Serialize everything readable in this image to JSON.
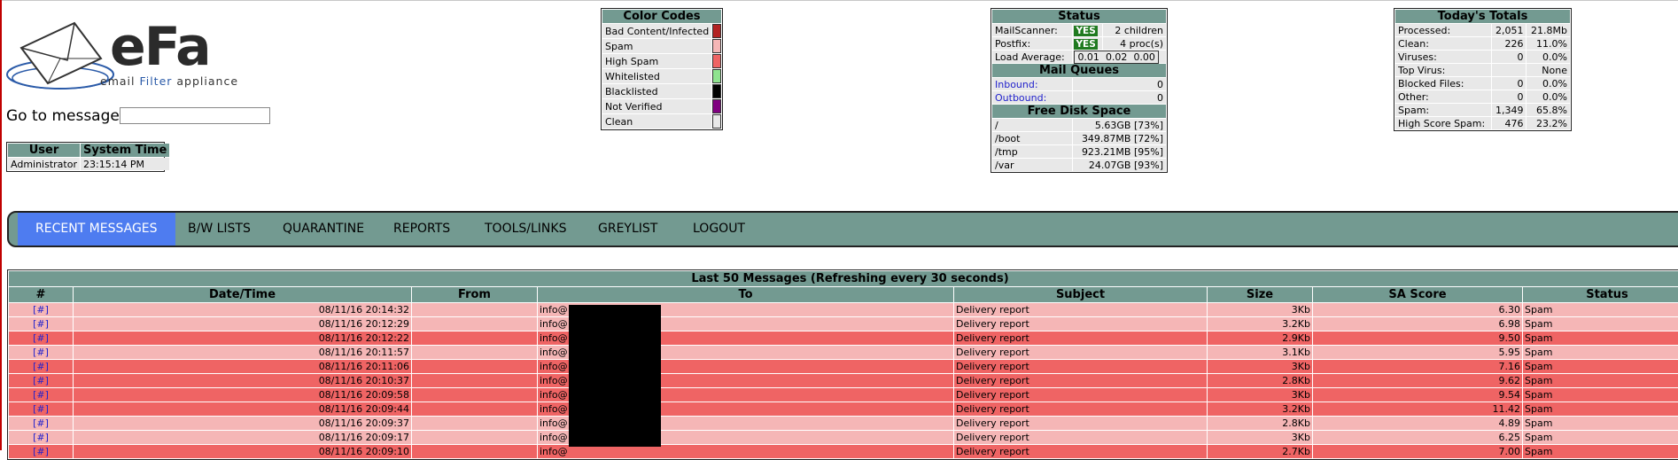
{
  "logo": {
    "main": "eFa",
    "sub_1": "email ",
    "sub_2": "Filter",
    "sub_3": " appliance"
  },
  "goto": {
    "label": "Go to message:",
    "value": ""
  },
  "user_box": {
    "headers": [
      "User",
      "System Time"
    ],
    "user": "Administrator",
    "time": "23:15:14 PM"
  },
  "color_codes": {
    "title": "Color Codes",
    "items": [
      {
        "label": "Bad Content/Infected",
        "color": "#b22222"
      },
      {
        "label": "Spam",
        "color": "#f5b6b6"
      },
      {
        "label": "High Spam",
        "color": "#ef6464"
      },
      {
        "label": "Whitelisted",
        "color": "#8fe38f"
      },
      {
        "label": "Blacklisted",
        "color": "#000000"
      },
      {
        "label": "Not Verified",
        "color": "#800080"
      },
      {
        "label": "Clean",
        "color": "#e8e8e8"
      }
    ]
  },
  "status": {
    "title": "Status",
    "mailscanner": {
      "label": "MailScanner:",
      "flag": "YES",
      "detail": "2 children"
    },
    "postfix": {
      "label": "Postfix:",
      "flag": "YES",
      "detail": "4 proc(s)"
    },
    "load": {
      "label": "Load Average:",
      "values": [
        "0.01",
        "0.02",
        "0.00"
      ]
    },
    "queues_title": "Mail Queues",
    "inbound": {
      "label": "Inbound:",
      "value": "0"
    },
    "outbound": {
      "label": "Outbound:",
      "value": "0"
    },
    "disk_title": "Free Disk Space",
    "disks": [
      {
        "mount": "/",
        "free": "5.63GB [73%]"
      },
      {
        "mount": "/boot",
        "free": "349.87MB [72%]"
      },
      {
        "mount": "/tmp",
        "free": "923.21MB [95%]"
      },
      {
        "mount": "/var",
        "free": "24.07GB [93%]"
      }
    ]
  },
  "totals": {
    "title": "Today's Totals",
    "rows": [
      {
        "label": "Processed:",
        "v1": "2,051",
        "v2": "21.8Mb"
      },
      {
        "label": "Clean:",
        "v1": "226",
        "v2": "11.0%"
      },
      {
        "label": "Viruses:",
        "v1": "0",
        "v2": "0.0%"
      },
      {
        "label": "Top Virus:",
        "v1": "",
        "v2": "None"
      },
      {
        "label": "Blocked Files:",
        "v1": "0",
        "v2": "0.0%"
      },
      {
        "label": "Other:",
        "v1": "0",
        "v2": "0.0%"
      },
      {
        "label": "Spam:",
        "v1": "1,349",
        "v2": "65.8%"
      },
      {
        "label": "High Score Spam:",
        "v1": "476",
        "v2": "23.2%"
      }
    ]
  },
  "nav": [
    "RECENT MESSAGES",
    "B/W LISTS",
    "QUARANTINE",
    "REPORTS",
    "TOOLS/LINKS",
    "GREYLIST",
    "LOGOUT"
  ],
  "messages": {
    "title": "Last 50 Messages (Refreshing every 30 seconds)",
    "headers": [
      "#",
      "Date/Time",
      "From",
      "To",
      "Subject",
      "Size",
      "SA Score",
      "Status"
    ],
    "rows": [
      {
        "hash": "[#]",
        "date": "08/11/16 20:14:32",
        "from": "",
        "to": "info@",
        "subject": "Delivery report",
        "size": "3Kb",
        "score": "6.30",
        "status": "Spam",
        "level": "spam"
      },
      {
        "hash": "[#]",
        "date": "08/11/16 20:12:29",
        "from": "",
        "to": "info@",
        "subject": "Delivery report",
        "size": "3.2Kb",
        "score": "6.98",
        "status": "Spam",
        "level": "spam"
      },
      {
        "hash": "[#]",
        "date": "08/11/16 20:12:22",
        "from": "",
        "to": "info@",
        "subject": "Delivery report",
        "size": "2.9Kb",
        "score": "9.50",
        "status": "Spam",
        "level": "high"
      },
      {
        "hash": "[#]",
        "date": "08/11/16 20:11:57",
        "from": "",
        "to": "info@",
        "subject": "Delivery report",
        "size": "3.1Kb",
        "score": "5.95",
        "status": "Spam",
        "level": "spam"
      },
      {
        "hash": "[#]",
        "date": "08/11/16 20:11:06",
        "from": "",
        "to": "info@",
        "subject": "Delivery report",
        "size": "3Kb",
        "score": "7.16",
        "status": "Spam",
        "level": "high"
      },
      {
        "hash": "[#]",
        "date": "08/11/16 20:10:37",
        "from": "",
        "to": "info@",
        "subject": "Delivery report",
        "size": "2.8Kb",
        "score": "9.62",
        "status": "Spam",
        "level": "high"
      },
      {
        "hash": "[#]",
        "date": "08/11/16 20:09:58",
        "from": "",
        "to": "info@",
        "subject": "Delivery report",
        "size": "3Kb",
        "score": "9.54",
        "status": "Spam",
        "level": "high"
      },
      {
        "hash": "[#]",
        "date": "08/11/16 20:09:44",
        "from": "",
        "to": "info@",
        "subject": "Delivery report",
        "size": "3.2Kb",
        "score": "11.42",
        "status": "Spam",
        "level": "high"
      },
      {
        "hash": "[#]",
        "date": "08/11/16 20:09:37",
        "from": "",
        "to": "info@",
        "subject": "Delivery report",
        "size": "2.8Kb",
        "score": "4.89",
        "status": "Spam",
        "level": "spam"
      },
      {
        "hash": "[#]",
        "date": "08/11/16 20:09:17",
        "from": "",
        "to": "info@",
        "subject": "Delivery report",
        "size": "3Kb",
        "score": "6.25",
        "status": "Spam",
        "level": "spam"
      },
      {
        "hash": "[#]",
        "date": "08/11/16 20:09:10",
        "from": "",
        "to": "info@",
        "subject": "Delivery report",
        "size": "2.7Kb",
        "score": "7.00",
        "status": "Spam",
        "level": "high"
      }
    ]
  }
}
